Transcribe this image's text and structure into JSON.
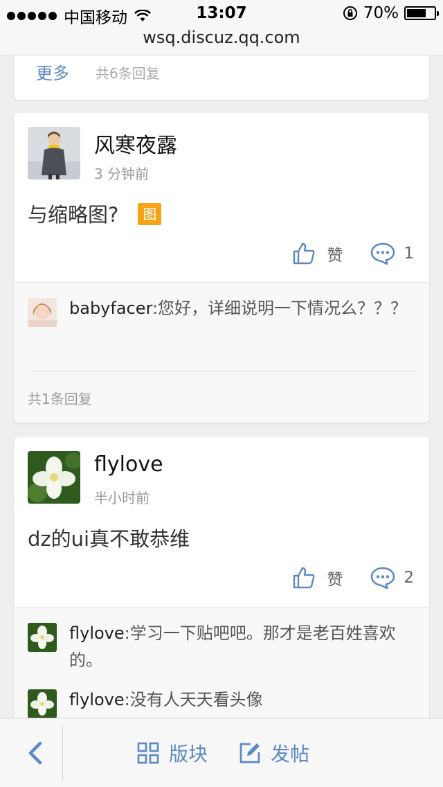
{
  "status_bar": {
    "carrier": "中国移动",
    "time": "13:07",
    "battery": "70%",
    "battery_level": 0.7
  },
  "url": "wsq.discuz.qq.com",
  "top_card": {
    "more_label": "更多",
    "reply_count": "共6条回复"
  },
  "posts": [
    {
      "username": "风寒夜露",
      "time": "3 分钟前",
      "content": "与缩略图?",
      "image_badge": "图",
      "like_label": "赞",
      "comment_count": "1",
      "replies": [
        {
          "name": "babyfacer",
          "sep": ":",
          "text": "您好，详细说明一下情况么？？？"
        }
      ],
      "total_replies": "共1条回复"
    },
    {
      "username": "flylove",
      "time": "半小时前",
      "content": "dz的ui真不敢恭维",
      "like_label": "赞",
      "comment_count": "2",
      "replies": [
        {
          "name": "flylove",
          "sep": ":",
          "text": "学习一下贴吧吧。那才是老百姓喜欢的。"
        },
        {
          "name": "flylove",
          "sep": ":",
          "text": "没有人天天看头像"
        }
      ]
    }
  ],
  "toolbar": {
    "forums_label": "版块",
    "post_label": "发帖"
  },
  "colors": {
    "accent": "#5a89c6",
    "badge": "#f7a318"
  },
  "icons": [
    "wifi-icon",
    "rotation-lock-icon",
    "battery-icon",
    "thumbs-up-icon",
    "comment-bubble-icon",
    "back-chevron-icon",
    "grid-icon",
    "edit-icon"
  ]
}
